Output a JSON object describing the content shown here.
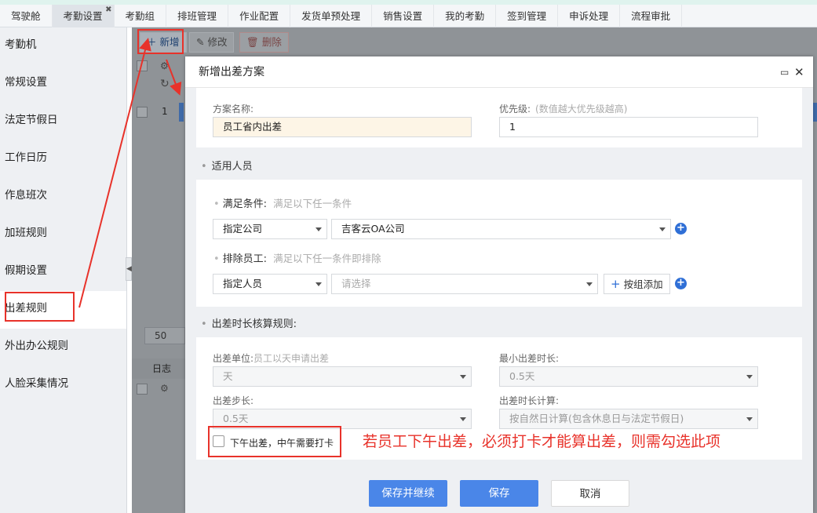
{
  "tabs": [
    {
      "label": "驾驶舱",
      "active": false
    },
    {
      "label": "考勤设置",
      "active": true
    },
    {
      "label": "考勤组",
      "active": false
    },
    {
      "label": "排班管理",
      "active": false
    },
    {
      "label": "作业配置",
      "active": false
    },
    {
      "label": "发货单预处理",
      "active": false
    },
    {
      "label": "销售设置",
      "active": false
    },
    {
      "label": "我的考勤",
      "active": false
    },
    {
      "label": "签到管理",
      "active": false
    },
    {
      "label": "申诉处理",
      "active": false
    },
    {
      "label": "流程审批",
      "active": false
    }
  ],
  "sidebar": {
    "items": [
      {
        "label": "考勤机"
      },
      {
        "label": "常规设置"
      },
      {
        "label": "法定节假日"
      },
      {
        "label": "工作日历"
      },
      {
        "label": "作息班次"
      },
      {
        "label": "加班规则"
      },
      {
        "label": "假期设置"
      },
      {
        "label": "出差规则"
      },
      {
        "label": "外出办公规则"
      },
      {
        "label": "人脸采集情况"
      }
    ],
    "active_index": 7
  },
  "toolbar": {
    "new_label": "新增",
    "edit_label": "修改",
    "delete_label": "删除"
  },
  "background_grid": {
    "row_number": "1",
    "page_size": "50",
    "log_tab": "日志"
  },
  "modal": {
    "title": "新增出差方案",
    "name_label": "方案名称:",
    "name_value": "员工省内出差",
    "priority_label": "优先级:",
    "priority_hint": "(数值越大优先级越高)",
    "priority_value": "1",
    "section_people": "适用人员",
    "condition_label": "满足条件:",
    "condition_hint": "满足以下任一条件",
    "condition_type": "指定公司",
    "condition_value": "吉客云OA公司",
    "exclude_label": "排除员工:",
    "exclude_hint": "满足以下任一条件即排除",
    "exclude_type": "指定人员",
    "exclude_placeholder": "请选择",
    "group_add_label": "按组添加",
    "section_rules": "出差时长核算规则:",
    "unit_label": "出差单位:",
    "unit_hint": "员工以天申请出差",
    "unit_value": "天",
    "min_label": "最小出差时长:",
    "min_value": "0.5天",
    "step_label": "出差步长:",
    "step_value": "0.5天",
    "calc_label": "出差时长计算:",
    "calc_value": "按自然日计算(包含休息日与法定节假日)",
    "checkbox_label": "下午出差，中午需要打卡",
    "checkbox_checked": false,
    "save_continue_label": "保存并继续",
    "save_label": "保存",
    "cancel_label": "取消"
  },
  "annotation": {
    "note": "若员工下午出差，必须打卡才能算出差，则需勾选此项",
    "color": "#e8322a"
  },
  "colors": {
    "primary": "#4a86e8",
    "plus_icon": "#2f6fd6",
    "name_input_bg": "#fdf5e6"
  }
}
